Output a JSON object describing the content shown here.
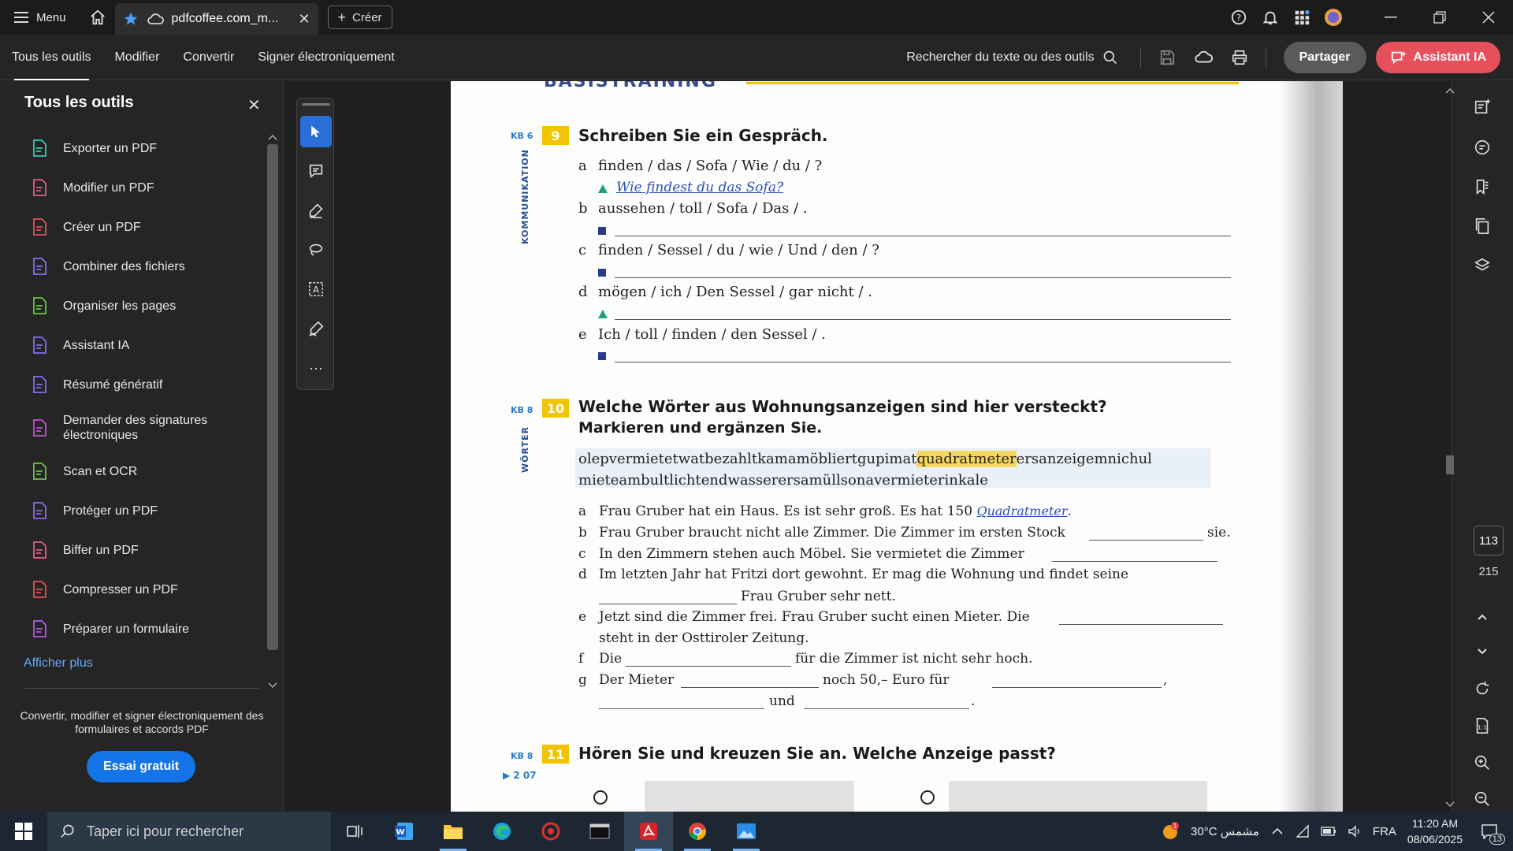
{
  "titlebar": {
    "menu_label": "Menu",
    "tab_title": "pdfcoffee.com_m...",
    "create_label": "Créer"
  },
  "toolbar": {
    "tabs": [
      "Tous les outils",
      "Modifier",
      "Convertir",
      "Signer électroniquement"
    ],
    "search_label": "Rechercher du texte ou des outils",
    "share_label": "Partager",
    "ai_label": "Assistant IA"
  },
  "left_panel": {
    "title": "Tous les outils",
    "tools": [
      {
        "label": "Exporter un PDF",
        "icon": "export-pdf-icon",
        "color": "#3ec8b0"
      },
      {
        "label": "Modifier un PDF",
        "icon": "edit-pdf-icon",
        "color": "#e65a8c"
      },
      {
        "label": "Créer un PDF",
        "icon": "create-pdf-icon",
        "color": "#e8505b"
      },
      {
        "label": "Combiner des fichiers",
        "icon": "combine-files-icon",
        "color": "#8b6cf2"
      },
      {
        "label": "Organiser les pages",
        "icon": "organize-pages-icon",
        "color": "#6cc24a"
      },
      {
        "label": "Assistant IA",
        "icon": "ai-assistant-icon",
        "color": "#8b6cf2"
      },
      {
        "label": "Résumé génératif",
        "icon": "generative-summary-icon",
        "color": "#8b6cf2"
      },
      {
        "label": "Demander des signatures électroniques",
        "icon": "request-signature-icon",
        "color": "#c64fd6"
      },
      {
        "label": "Scan et OCR",
        "icon": "scan-ocr-icon",
        "color": "#6cc24a"
      },
      {
        "label": "Protéger un PDF",
        "icon": "protect-pdf-icon",
        "color": "#8b6cf2"
      },
      {
        "label": "Biffer un PDF",
        "icon": "redact-pdf-icon",
        "color": "#e65a8c"
      },
      {
        "label": "Compresser un PDF",
        "icon": "compress-pdf-icon",
        "color": "#e8505b"
      },
      {
        "label": "Préparer un formulaire",
        "icon": "prepare-form-icon",
        "color": "#b05ce6"
      }
    ],
    "show_more": "Afficher plus",
    "promo": "Convertir, modifier et signer électroniquement des formulaires et accords PDF",
    "trial_label": "Essai gratuit"
  },
  "document": {
    "header_partial": "BASISTRAINING",
    "ex9": {
      "kb": "KB 6",
      "number": "9",
      "title": "Schreiben Sie ein Gespräch.",
      "side_label": "KOMMUNIKATION",
      "items": [
        {
          "letter": "a",
          "text": "finden / das / Sofa / Wie / du / ?",
          "answer": "Wie findest du das Sofa?",
          "marker": "triangle"
        },
        {
          "letter": "b",
          "text": "aussehen / toll / Sofa / Das / .",
          "answer": "",
          "marker": "square"
        },
        {
          "letter": "c",
          "text": "finden / Sessel / du / wie / Und / den / ?",
          "answer": "",
          "marker": "square"
        },
        {
          "letter": "d",
          "text": "mögen / ich / Den Sessel / gar nicht / .",
          "answer": "",
          "marker": "triangle"
        },
        {
          "letter": "e",
          "text": "Ich / toll / finden / den Sessel / .",
          "answer": "",
          "marker": "square"
        }
      ]
    },
    "ex10": {
      "kb": "KB 8",
      "number": "10",
      "title": "Welche Wörter aus Wohnungsanzeigen sind hier versteckt?",
      "subtitle": "Markieren und ergänzen Sie.",
      "side_label": "WÖRTER",
      "puzzle_before": "olepvermietetwatbezahltkamamöbliertgupimat",
      "puzzle_highlight": "quadratmeter",
      "puzzle_after": "ersanzeigemnichul",
      "puzzle_line2": "mieteambultlichtendwasserersamüllsonavermieterinkale",
      "sentences": {
        "a_letter": "a",
        "a_text": "Frau Gruber hat ein Haus. Es ist sehr groß. Es hat 150",
        "a_answer": "Quadratmeter",
        "b_letter": "b",
        "b_text": "Frau Gruber braucht nicht alle Zimmer. Die Zimmer im ersten Stock",
        "b_end": "sie.",
        "c_letter": "c",
        "c_text": "In den Zimmern stehen auch Möbel. Sie vermietet die Zimmer",
        "d_letter": "d",
        "d_text": "Im letzten Jahr hat Fritzi dort gewohnt. Er mag die Wohnung und findet seine",
        "d_text2": "Frau Gruber sehr nett.",
        "e_letter": "e",
        "e_text": "Jetzt sind die Zimmer frei. Frau Gruber sucht einen Mieter. Die",
        "e_text2": "steht in der Osttiroler Zeitung.",
        "f_letter": "f",
        "f_text": "Die",
        "f_text2": "für die Zimmer ist nicht sehr hoch.",
        "g_letter": "g",
        "g_text": "Der Mieter",
        "g_text2": "noch 50,– Euro für",
        "g_comma": ",",
        "g_und": "und"
      }
    },
    "ex11": {
      "kb": "KB 8",
      "number": "11",
      "title": "Hören Sie und kreuzen Sie an. Welche Anzeige passt?",
      "audio": "2 07"
    }
  },
  "page_nav": {
    "current": "113",
    "total": "215"
  },
  "taskbar": {
    "search_placeholder": "Taper ici pour rechercher",
    "weather": "30°C  مشمس",
    "lang": "FRA",
    "time": "11:20 AM",
    "date": "08/06/2025",
    "notif_count": "13"
  }
}
